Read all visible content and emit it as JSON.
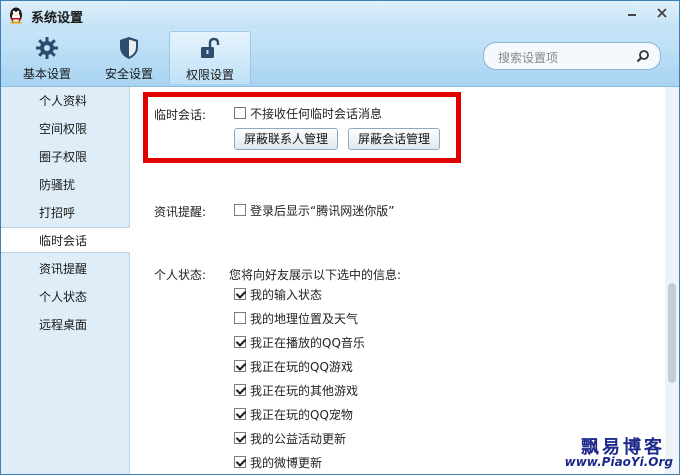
{
  "window": {
    "title": "系统设置",
    "minimize_icon": "minimize-icon",
    "close_icon": "close-icon"
  },
  "toolbar": {
    "tabs": [
      {
        "label": "基本设置",
        "icon": "gear-icon"
      },
      {
        "label": "安全设置",
        "icon": "shield-icon"
      },
      {
        "label": "权限设置",
        "icon": "unlock-icon",
        "active": true
      }
    ],
    "search": {
      "placeholder": "搜索设置项",
      "icon": "search-icon"
    }
  },
  "sidebar": {
    "items": [
      {
        "label": "个人资料"
      },
      {
        "label": "空间权限"
      },
      {
        "label": "圈子权限"
      },
      {
        "label": "防骚扰"
      },
      {
        "label": "打招呼"
      },
      {
        "label": "临时会话",
        "active": true
      },
      {
        "label": "资讯提醒"
      },
      {
        "label": "个人状态"
      },
      {
        "label": "远程桌面"
      }
    ]
  },
  "temp_chat": {
    "label": "临时会话:",
    "option": {
      "text": "不接收任何临时会话消息",
      "checked": false
    },
    "buttons": [
      "屏蔽联系人管理",
      "屏蔽会话管理"
    ]
  },
  "news": {
    "label": "资讯提醒:",
    "option": {
      "text": "登录后显示“腾讯网迷你版”",
      "checked": false
    }
  },
  "status": {
    "label": "个人状态:",
    "description": "您将向好友展示以下选中的信息:",
    "options": [
      {
        "text": "我的输入状态",
        "checked": true
      },
      {
        "text": "我的地理位置及天气",
        "checked": false
      },
      {
        "text": "我正在播放的QQ音乐",
        "checked": true
      },
      {
        "text": "我正在玩的QQ游戏",
        "checked": true
      },
      {
        "text": "我正在玩的其他游戏",
        "checked": true
      },
      {
        "text": "我正在玩的QQ宠物",
        "checked": true
      },
      {
        "text": "我的公益活动更新",
        "checked": true
      },
      {
        "text": "我的微博更新",
        "checked": true
      }
    ]
  },
  "watermark": {
    "line1": "飘易博客",
    "line2": "www.PiaoYi.Org"
  },
  "colors": {
    "highlight": "#e10000",
    "sidebar_bg": "#deedf8",
    "toolbar_bg": "#b8dcf4"
  }
}
